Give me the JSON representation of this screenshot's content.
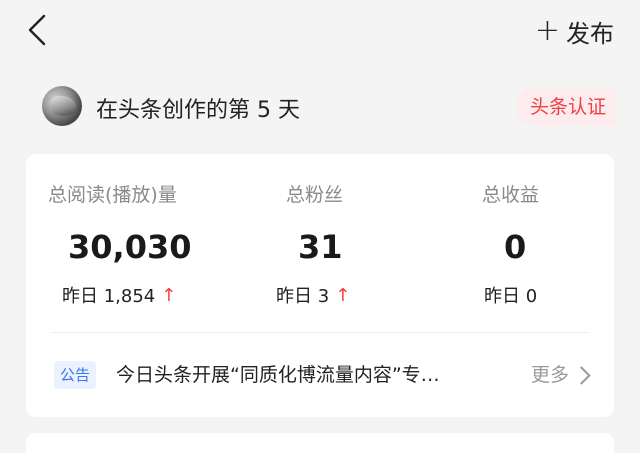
{
  "header": {
    "back_icon": "chevron-left-icon",
    "publish_plus": "+",
    "publish_label": "发布"
  },
  "profile": {
    "title": "在头条创作的第 5 天",
    "badge": "头条认证"
  },
  "stats": [
    {
      "label": "总阅读(播放)量",
      "value": "30,030",
      "sub": "昨日 1,854",
      "trend": "up"
    },
    {
      "label": "总粉丝",
      "value": "31",
      "sub": "昨日 3",
      "trend": "up"
    },
    {
      "label": "总收益",
      "value": "0",
      "sub": "昨日 0",
      "trend": "none"
    }
  ],
  "notice": {
    "tag": "公告",
    "text": "今日头条开展“同质化博流量内容”专…",
    "more": "更多"
  },
  "colors": {
    "accent_red": "#f04142",
    "notice_blue": "#3a76f0",
    "background": "#f4f4f4"
  }
}
